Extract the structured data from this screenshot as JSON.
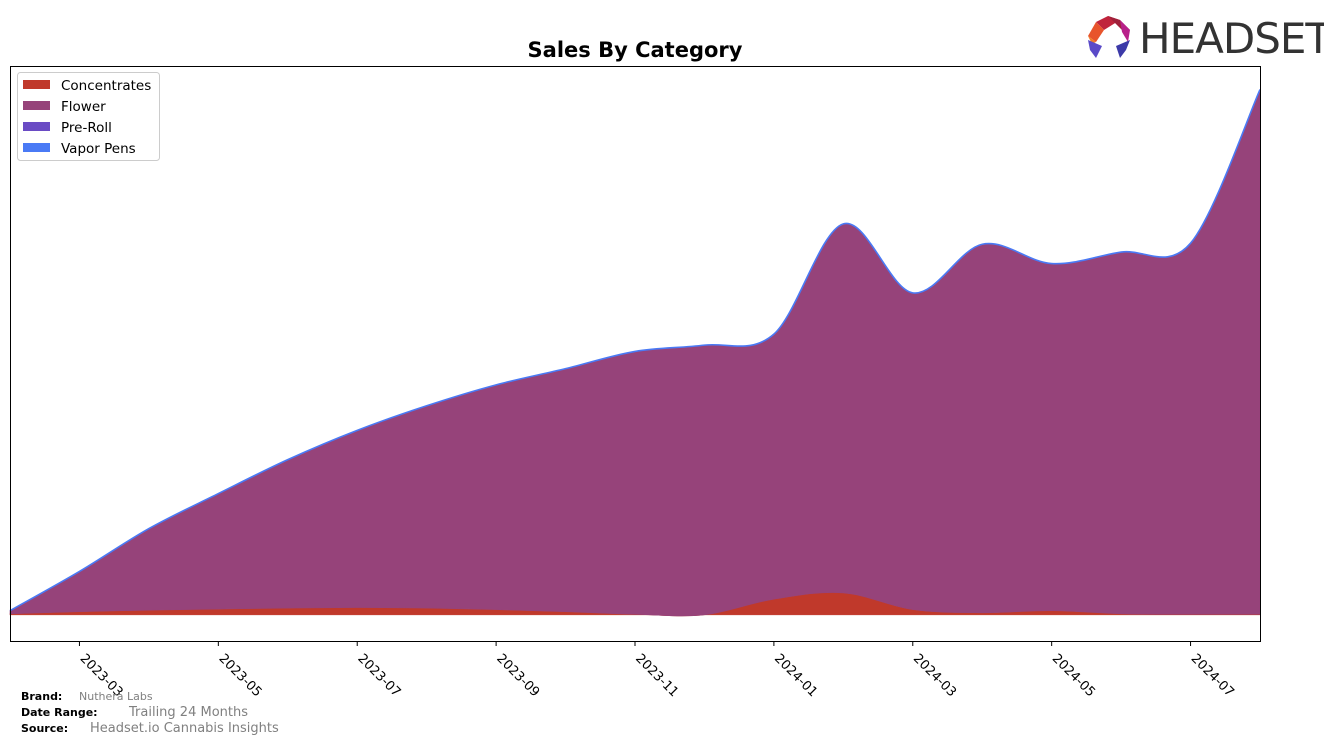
{
  "chart_data": {
    "type": "area",
    "stacked": true,
    "title": "Sales By Category",
    "xlabel": "",
    "ylabel": "",
    "x": [
      "2023-02",
      "2023-03",
      "2023-04",
      "2023-05",
      "2023-06",
      "2023-07",
      "2023-08",
      "2023-09",
      "2023-10",
      "2023-11",
      "2023-12",
      "2024-01",
      "2024-02",
      "2024-03",
      "2024-04",
      "2024-05",
      "2024-06",
      "2024-07",
      "2024-08"
    ],
    "xticks": [
      "2023-03",
      "2023-05",
      "2023-07",
      "2023-09",
      "2023-11",
      "2024-01",
      "2024-03",
      "2024-05",
      "2024-07"
    ],
    "yticks_visible": false,
    "ylim": [
      -5,
      105
    ],
    "legend_position": "top-left",
    "series": [
      {
        "name": "Concentrates",
        "color": "#c0392b",
        "values": [
          0.2,
          0.6,
          0.9,
          1.1,
          1.3,
          1.4,
          1.3,
          1.0,
          0.6,
          0.1,
          0.0,
          3.0,
          4.2,
          1.0,
          0.4,
          0.8,
          0.2,
          0.1,
          0.1
        ]
      },
      {
        "name": "Flower",
        "color": "#96437a",
        "values": [
          0.6,
          7.7,
          15.6,
          22.1,
          28.4,
          33.9,
          38.7,
          43.0,
          46.5,
          50.3,
          51.6,
          50.7,
          70.6,
          60.6,
          70.5,
          66.4,
          69.2,
          71.0,
          100.4
        ]
      },
      {
        "name": "Pre-Roll",
        "color": "#6a4bc4",
        "values": [
          0,
          0,
          0,
          0,
          0,
          0,
          0,
          0,
          0,
          0,
          0,
          0,
          0,
          0,
          0,
          0,
          0,
          0,
          0
        ]
      },
      {
        "name": "Vapor Pens",
        "color": "#4a7af5",
        "values": [
          0,
          0,
          0,
          0,
          0,
          0,
          0,
          0,
          0,
          0,
          0,
          0,
          0,
          0,
          0,
          0,
          0,
          0,
          0
        ]
      }
    ]
  },
  "footer": {
    "brand_label": "Brand:",
    "brand_value": "Nuthera Labs",
    "date_range_label": "Date Range:",
    "date_range_value": "Trailing 24 Months",
    "source_label": "Source:",
    "source_value": "Headset.io Cannabis Insights"
  },
  "logo": {
    "text": "HEADSET"
  }
}
